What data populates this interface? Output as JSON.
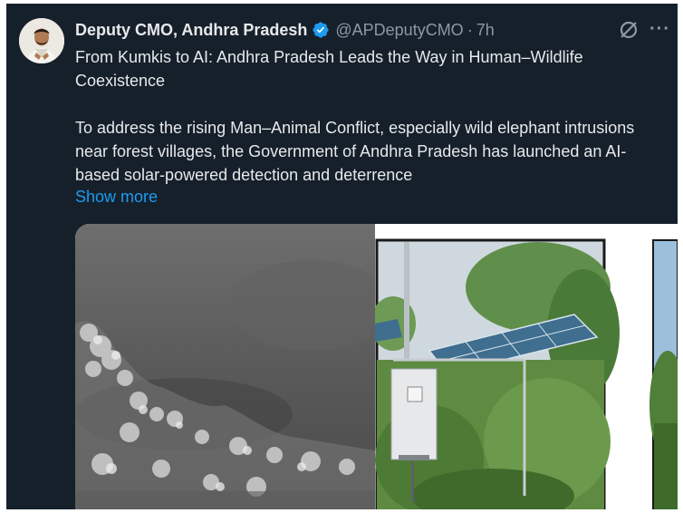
{
  "post": {
    "author_name": "Deputy CMO, Andhra Pradesh",
    "handle": "@APDeputyCMO",
    "separator": "·",
    "time": "7h",
    "title_line": "From Kumkis to AI: Andhra Pradesh Leads the Way in Human–Wildlife Coexistence",
    "body": "To address the rising Man–Animal Conflict, especially wild elephant intrusions near forest villages, the Government of Andhra Pradesh has launched an AI-based solar-powered detection and deterrence",
    "show_more": "Show more",
    "more_menu": "···"
  },
  "colors": {
    "background": "#15202b",
    "primary_text": "#e7e9ea",
    "secondary_text": "#8b98a5",
    "link": "#1d9bf0",
    "verified_badge": "#1d9bf0"
  },
  "icons": {
    "verified": "verified-badge-icon",
    "grok": "grok-icon",
    "more": "more-options-icon"
  },
  "media": {
    "images": [
      {
        "kind": "thermal-camera-night-view"
      },
      {
        "kind": "solar-panel-detection-unit"
      },
      {
        "kind": "partial-forest-photo"
      }
    ]
  }
}
